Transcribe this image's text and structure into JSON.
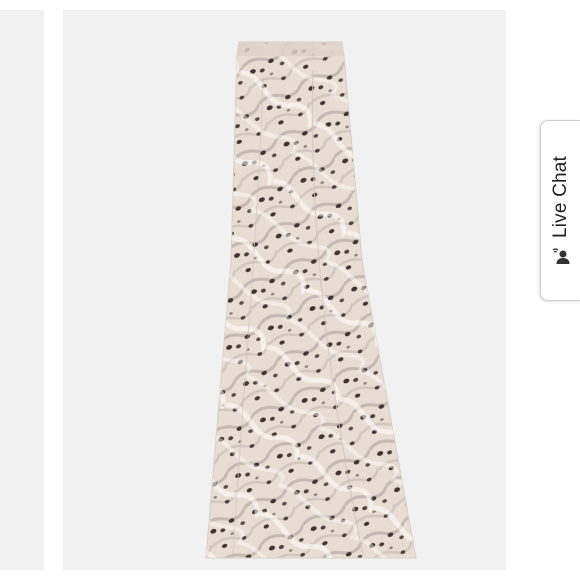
{
  "live_chat": {
    "label": "Live Chat",
    "icon": "chat-person-icon"
  },
  "colors": {
    "gallery_background": "#f1f1f1",
    "skirt_base": "#e8ddd3",
    "print_dark": "#3f3432",
    "print_grey": "#9d958f"
  }
}
